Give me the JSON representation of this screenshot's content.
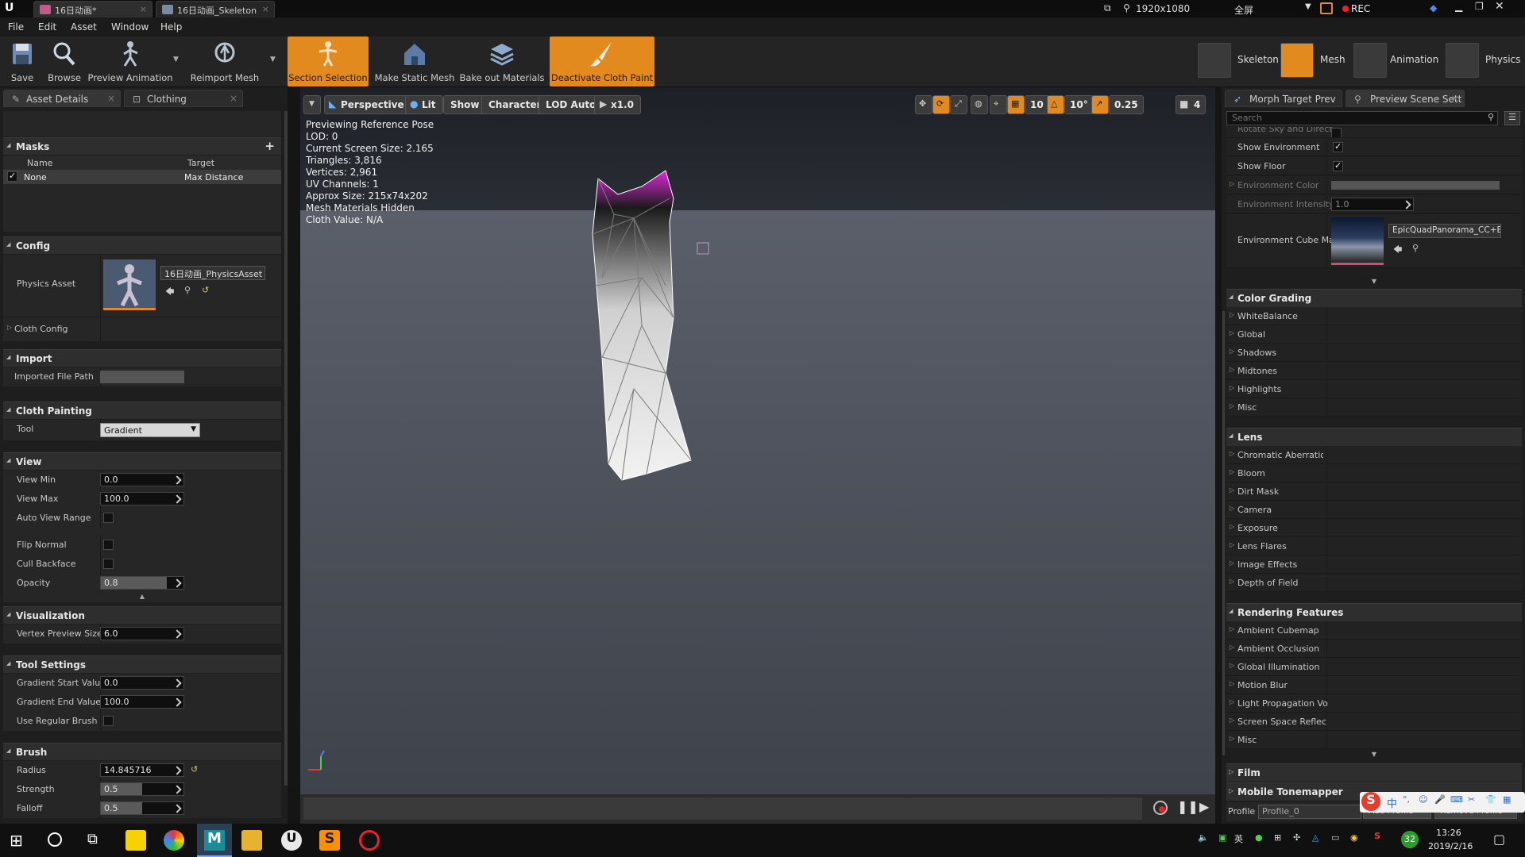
{
  "titlebar": {
    "tabs": [
      {
        "label": "16日动画*",
        "active": true
      },
      {
        "label": "16日动画_Skeleton",
        "active": false
      }
    ],
    "resolution": "1920x1080",
    "fullscreen": "全屏",
    "rec": "REC"
  },
  "menu": [
    "File",
    "Edit",
    "Asset",
    "Window",
    "Help"
  ],
  "toolbar": {
    "buttons": [
      "Save",
      "Browse",
      "Preview Animation",
      "Reimport Mesh",
      "Section Selection",
      "Make Static Mesh",
      "Bake out Materials",
      "Deactivate Cloth Paint"
    ],
    "modes": [
      "Skeleton",
      "Mesh",
      "Animation",
      "Physics"
    ]
  },
  "left": {
    "tabs": [
      "Asset Details",
      "Clothing"
    ],
    "masks": {
      "title": "Masks",
      "col_name": "Name",
      "col_target": "Target",
      "row_name": "None",
      "row_target": "Max Distance"
    },
    "config": {
      "title": "Config",
      "physics_asset_label": "Physics Asset",
      "physics_asset_value": "16日动画_PhysicsAsset",
      "cloth_config": "Cloth Config"
    },
    "import": {
      "title": "Import",
      "path_label": "Imported File Path"
    },
    "painting": {
      "title": "Cloth Painting",
      "tool_label": "Tool",
      "tool_value": "Gradient"
    },
    "view": {
      "title": "View",
      "min_label": "View Min",
      "min": "0.0",
      "max_label": "View Max",
      "max": "100.0",
      "auto_label": "Auto View Range",
      "flip_label": "Flip Normal",
      "cull_label": "Cull Backface",
      "opacity_label": "Opacity",
      "opacity": "0.8"
    },
    "visualization": {
      "title": "Visualization",
      "vps_label": "Vertex Preview Size",
      "vps": "6.0"
    },
    "tool_settings": {
      "title": "Tool Settings",
      "gs_label": "Gradient Start Value",
      "gs": "0.0",
      "ge_label": "Gradient End Value",
      "ge": "100.0",
      "brush_label": "Use Regular Brush"
    },
    "brush": {
      "title": "Brush",
      "radius_label": "Radius",
      "radius": "14.845716",
      "strength_label": "Strength",
      "strength": "0.5",
      "falloff_label": "Falloff",
      "falloff": "0.5"
    }
  },
  "viewport": {
    "perspective": "Perspective",
    "lit": "Lit",
    "show": "Show",
    "character": "Character",
    "lod": "LOD Auto",
    "speed": "x1.0",
    "grid": "10",
    "angle": "10°",
    "scale": "0.25",
    "cam": "4",
    "info": [
      "Previewing Reference Pose",
      "LOD: 0",
      "Current Screen Size: 2.165",
      "Triangles: 3,816",
      "Vertices: 2,961",
      "UV Channels: 1",
      "Approx Size: 215x74x202",
      "Mesh Materials Hidden",
      "Cloth Value: N/A"
    ]
  },
  "right": {
    "tabs": [
      "Morph Target Prev",
      "Preview Scene Sett"
    ],
    "search_placeholder": "Search",
    "partial_row": "Rotate Sky and Direct",
    "show_env": "Show Environment",
    "show_floor": "Show Floor",
    "env_color": "Environment Color",
    "env_intensity": "Environment Intensity",
    "env_intensity_val": "1.0",
    "env_cube": "Environment Cube Ma",
    "env_cube_val": "EpicQuadPanorama_CC+EV",
    "sections": [
      {
        "title": "Color Grading",
        "items": [
          "WhiteBalance",
          "Global",
          "Shadows",
          "Midtones",
          "Highlights",
          "Misc"
        ]
      },
      {
        "title": "Lens",
        "items": [
          "Chromatic Aberration",
          "Bloom",
          "Dirt Mask",
          "Camera",
          "Exposure",
          "Lens Flares",
          "Image Effects",
          "Depth of Field"
        ]
      },
      {
        "title": "Rendering Features",
        "items": [
          "Ambient Cubemap",
          "Ambient Occlusion",
          "Global Illumination",
          "Motion Blur",
          "Light Propagation Vo",
          "Screen Space Reflec",
          "Misc"
        ]
      }
    ],
    "film": "Film",
    "mobile": "Mobile Tonemapper",
    "profile_label": "Profile",
    "profile_value": "Profile_0",
    "add_profile": "Add Profile",
    "remove_profile": "Remove Profile"
  },
  "taskbar": {
    "time": "13:26",
    "date": "2019/2/16",
    "badge": "32"
  },
  "colors": {
    "accent": "#e28a1d",
    "magenta": "#e028d8"
  }
}
